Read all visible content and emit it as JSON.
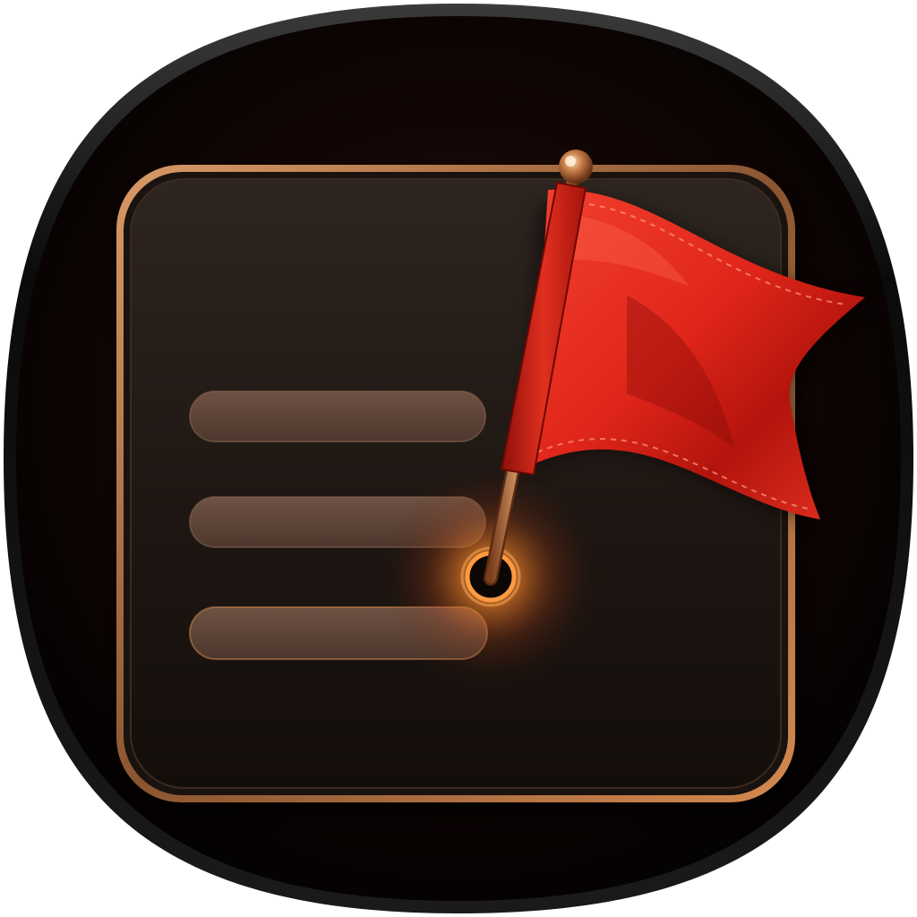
{
  "app_icon": {
    "name": "flagged-list-icon",
    "colors": {
      "background_outer": "#050202",
      "background_inner": "#1f0d08",
      "card_fill": "#2c211c",
      "card_border": "#c98552",
      "list_bar": "#7a5a48",
      "flag_red": "#e3261c",
      "flag_dark_red": "#8c0d08",
      "pole_copper": "#c47a45",
      "glow_orange": "#ff8a2a"
    },
    "list_bar_count": 3,
    "icons": [
      "rounded-square-card-icon",
      "list-lines-icon",
      "red-flag-icon",
      "flag-pole-icon"
    ]
  }
}
